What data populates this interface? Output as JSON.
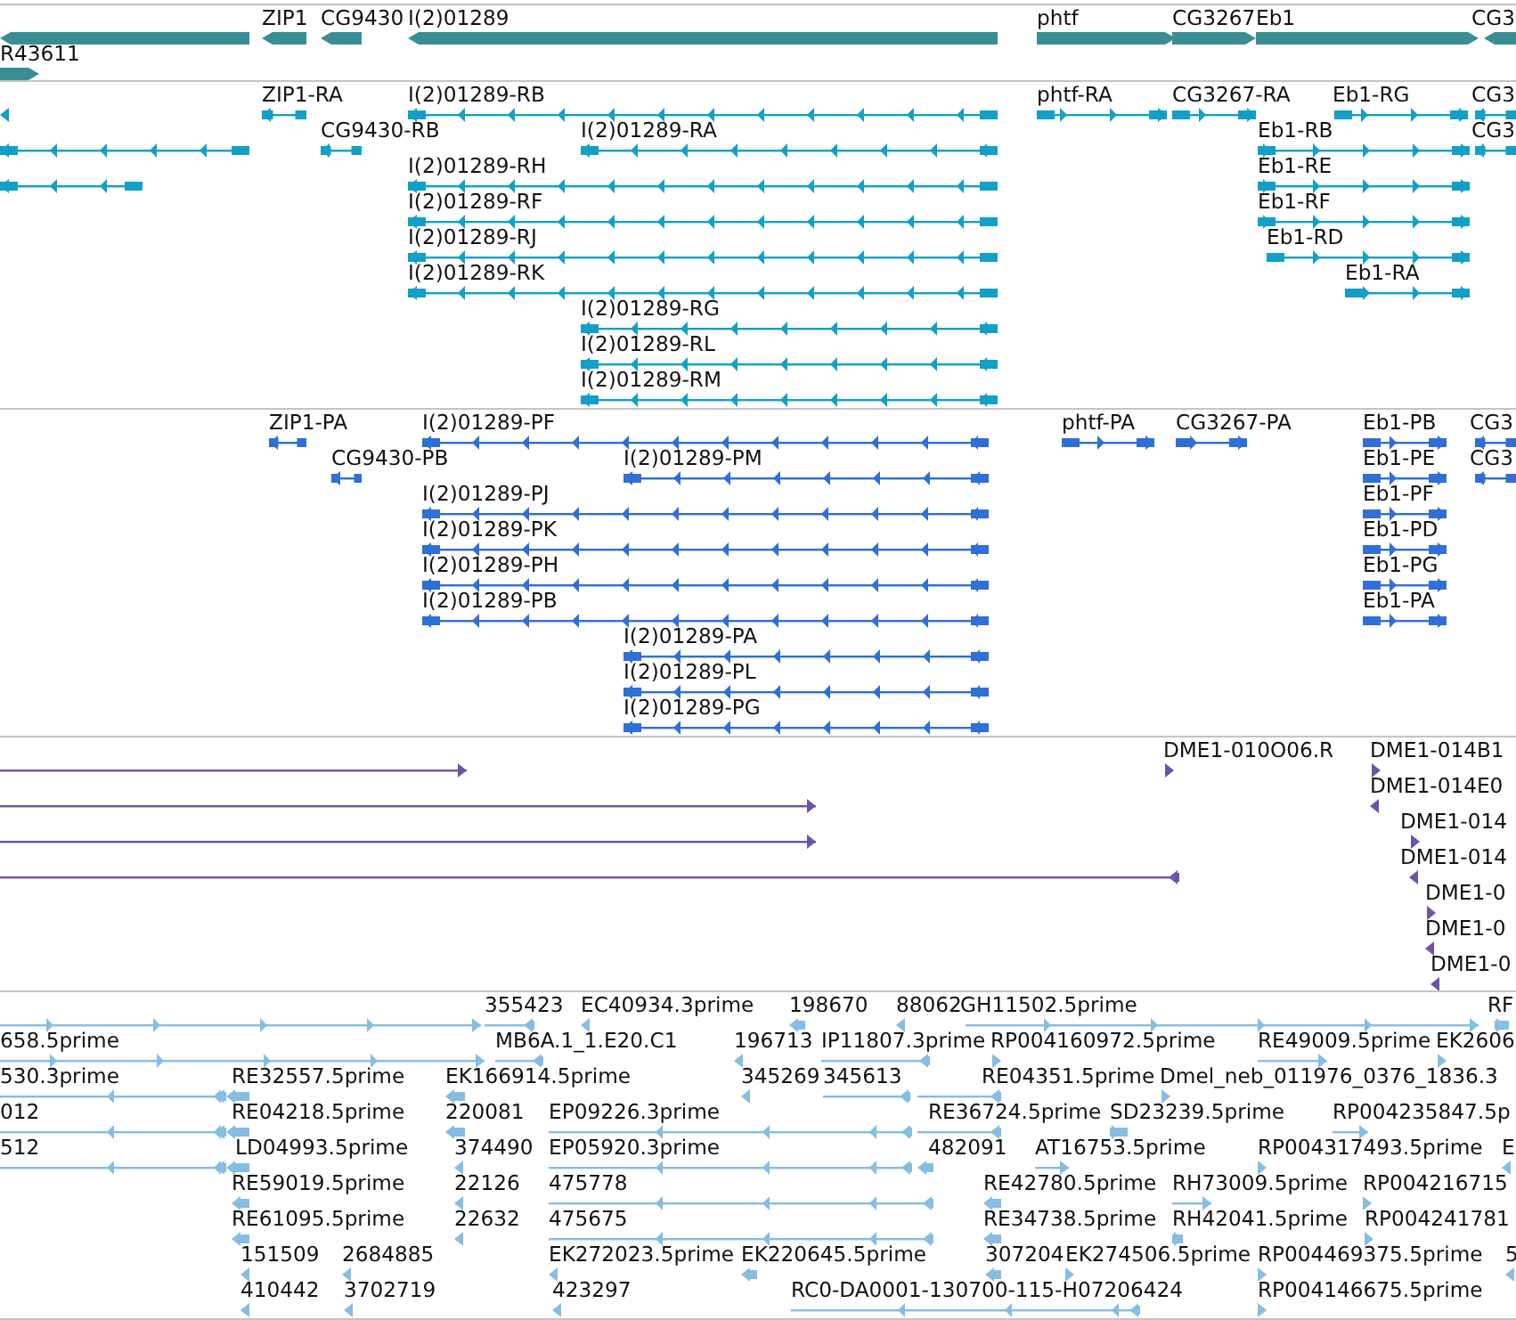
{
  "tracks": [
    {
      "kind": "gene",
      "lanes": [
        {
          "features": [
            {
              "reverse": true
            },
            {
              "label": "ZIP1",
              "reverse": true
            },
            {
              "label": "CG9430",
              "reverse": true
            },
            {
              "label": "I(2)01289",
              "reverse": true
            },
            {
              "label": "phtf",
              "reverse": false
            },
            {
              "label": "CG3267",
              "reverse": false
            },
            {
              "label": "Eb1",
              "reverse": false
            },
            {
              "label": "CG3",
              "reverse": true
            }
          ]
        },
        {
          "features": [
            {
              "label": "R43611",
              "reverse": false
            }
          ]
        }
      ]
    },
    {
      "kind": "transcript",
      "lanes": [
        {
          "features": [
            {
              "reverse": true
            },
            {
              "label": "ZIP1-RA",
              "reverse": true
            },
            {
              "label": "I(2)01289-RB",
              "reverse": true
            },
            {
              "label": "phtf-RA",
              "reverse": false
            },
            {
              "label": "CG3267-RA",
              "reverse": false
            },
            {
              "label": "Eb1-RG",
              "reverse": false
            },
            {
              "label": "CG3",
              "reverse": true
            }
          ]
        },
        {
          "features": [
            {
              "reverse": true
            },
            {
              "label": "CG9430-RB",
              "reverse": true
            },
            {
              "label": "I(2)01289-RA",
              "reverse": true
            },
            {
              "label": "Eb1-RB",
              "reverse": false
            },
            {
              "label": "CG3",
              "reverse": true
            }
          ]
        },
        {
          "features": [
            {
              "reverse": true
            },
            {
              "label": "I(2)01289-RH",
              "reverse": true
            },
            {
              "label": "Eb1-RE",
              "reverse": false
            }
          ]
        },
        {
          "features": [
            {
              "label": "I(2)01289-RF",
              "reverse": true
            },
            {
              "label": "Eb1-RF",
              "reverse": false
            }
          ]
        },
        {
          "features": [
            {
              "label": "I(2)01289-RJ",
              "reverse": true
            },
            {
              "label": "Eb1-RD",
              "reverse": false
            }
          ]
        },
        {
          "features": [
            {
              "label": "I(2)01289-RK",
              "reverse": true
            },
            {
              "label": "Eb1-RA",
              "reverse": false
            }
          ]
        },
        {
          "features": [
            {
              "label": "I(2)01289-RG",
              "reverse": true
            }
          ]
        },
        {
          "features": [
            {
              "label": "I(2)01289-RL",
              "reverse": true
            }
          ]
        },
        {
          "features": [
            {
              "label": "I(2)01289-RM",
              "reverse": true
            }
          ]
        }
      ]
    },
    {
      "kind": "protein",
      "lanes": [
        {
          "features": [
            {
              "label": "ZIP1-PA",
              "reverse": true
            },
            {
              "label": "I(2)01289-PF",
              "reverse": true
            },
            {
              "label": "phtf-PA",
              "reverse": false
            },
            {
              "label": "CG3267-PA",
              "reverse": false
            },
            {
              "label": "Eb1-PB",
              "reverse": false
            },
            {
              "label": "CG3",
              "reverse": true
            }
          ]
        },
        {
          "features": [
            {
              "label": "CG9430-PB",
              "reverse": true
            },
            {
              "label": "I(2)01289-PM",
              "reverse": true
            },
            {
              "label": "Eb1-PE",
              "reverse": false
            },
            {
              "label": "CG3",
              "reverse": true
            }
          ]
        },
        {
          "features": [
            {
              "label": "I(2)01289-PJ",
              "reverse": true
            },
            {
              "label": "Eb1-PF",
              "reverse": false
            }
          ]
        },
        {
          "features": [
            {
              "label": "I(2)01289-PK",
              "reverse": true
            },
            {
              "label": "Eb1-PD",
              "reverse": false
            }
          ]
        },
        {
          "features": [
            {
              "label": "I(2)01289-PH",
              "reverse": true
            },
            {
              "label": "Eb1-PG",
              "reverse": false
            }
          ]
        },
        {
          "features": [
            {
              "label": "I(2)01289-PB",
              "reverse": true
            },
            {
              "label": "Eb1-PA",
              "reverse": false
            }
          ]
        },
        {
          "features": [
            {
              "label": "I(2)01289-PA",
              "reverse": true
            }
          ]
        },
        {
          "features": [
            {
              "label": "I(2)01289-PL",
              "reverse": true
            }
          ]
        },
        {
          "features": [
            {
              "label": "I(2)01289-PG",
              "reverse": true
            }
          ]
        }
      ]
    },
    {
      "kind": "clone",
      "lanes": [
        {
          "features": [
            {
              "reverse": false
            },
            {
              "label": "DME1-010O06.R",
              "reverse": false
            },
            {
              "label": "DME1-014B1",
              "reverse": false
            }
          ]
        },
        {
          "features": [
            {
              "reverse": false
            },
            {
              "label": "DME1-014E0",
              "reverse": true
            }
          ]
        },
        {
          "features": [
            {
              "reverse": false
            },
            {
              "label": "DME1-014",
              "reverse": false
            }
          ]
        },
        {
          "features": [
            {
              "reverse": true
            },
            {
              "label": "DME1-014",
              "reverse": true
            }
          ]
        },
        {
          "features": [
            {
              "label": "DME1-0",
              "reverse": false
            }
          ]
        },
        {
          "features": [
            {
              "label": "DME1-0",
              "reverse": true
            }
          ]
        },
        {
          "features": [
            {
              "label": "DME1-0",
              "reverse": true
            }
          ]
        }
      ]
    },
    {
      "kind": "est",
      "lanes": [
        {
          "features": [
            {
              "reverse": false
            },
            {
              "label": "355423",
              "reverse": true
            },
            {
              "label": "EC40934.3prime",
              "reverse": true
            },
            {
              "label": "198670",
              "reverse": true
            },
            {
              "label": "88062",
              "reverse": true
            },
            {
              "label": "GH11502.5prime",
              "reverse": false
            },
            {
              "label": "RF",
              "reverse": false
            }
          ]
        },
        {
          "features": [
            {
              "label": "658.5prime",
              "reverse": false
            },
            {
              "label": "MB6A.1_1.E20.C1",
              "reverse": true
            },
            {
              "label": "196713",
              "reverse": true
            },
            {
              "label": "IP11807.3prime",
              "reverse": true
            },
            {
              "label": "RP004160972.5prime",
              "reverse": false
            },
            {
              "label": "RE49009.5prime",
              "reverse": false
            },
            {
              "label": "EK2606",
              "reverse": false
            }
          ]
        },
        {
          "features": [
            {
              "label": "530.3prime",
              "reverse": true
            },
            {
              "label": "RE32557.5prime",
              "reverse": true
            },
            {
              "label": "EK166914.5prime",
              "reverse": true
            },
            {
              "label": "345269",
              "reverse": true
            },
            {
              "label": "345613",
              "reverse": true
            },
            {
              "label": "RE04351.5prime",
              "reverse": true
            },
            {
              "label": "Dmel_neb_011976_0376_1836.3",
              "reverse": false
            }
          ]
        },
        {
          "features": [
            {
              "label": "012",
              "reverse": true
            },
            {
              "label": "RE04218.5prime",
              "reverse": true
            },
            {
              "label": "220081",
              "reverse": true
            },
            {
              "label": "EP09226.3prime",
              "reverse": true
            },
            {
              "label": "RE36724.5prime",
              "reverse": true
            },
            {
              "label": "SD23239.5prime",
              "reverse": false
            },
            {
              "label": "RP004235847.5p",
              "reverse": false
            }
          ]
        },
        {
          "features": [
            {
              "label": "512",
              "reverse": true
            },
            {
              "label": "LD04993.5prime",
              "reverse": true
            },
            {
              "label": "374490",
              "reverse": true
            },
            {
              "label": "EP05920.3prime",
              "reverse": true
            },
            {
              "label": "482091",
              "reverse": true
            },
            {
              "label": "AT16753.5prime",
              "reverse": false
            },
            {
              "label": "RP004317493.5prime",
              "reverse": false
            },
            {
              "label": "E",
              "reverse": true
            }
          ]
        },
        {
          "features": [
            {
              "label": "RE59019.5prime",
              "reverse": true
            },
            {
              "label": "22126",
              "reverse": true
            },
            {
              "label": "475778",
              "reverse": true
            },
            {
              "label": "RE42780.5prime",
              "reverse": true
            },
            {
              "label": "RH73009.5prime",
              "reverse": false
            },
            {
              "label": "RP004216715",
              "reverse": false
            }
          ]
        },
        {
          "features": [
            {
              "label": "RE61095.5prime",
              "reverse": true
            },
            {
              "label": "22632",
              "reverse": true
            },
            {
              "label": "475675",
              "reverse": true
            },
            {
              "label": "RE34738.5prime",
              "reverse": true
            },
            {
              "label": "RH42041.5prime",
              "reverse": false
            },
            {
              "label": "RP004241781",
              "reverse": false
            }
          ]
        },
        {
          "features": [
            {
              "label": "151509",
              "reverse": true
            },
            {
              "label": "2684885",
              "reverse": true
            },
            {
              "label": "EK272023.5prime",
              "reverse": true
            },
            {
              "label": "EK220645.5prime",
              "reverse": true
            },
            {
              "label": "307204",
              "reverse": true
            },
            {
              "label": "EK274506.5prime",
              "reverse": false
            },
            {
              "label": "RP004469375.5prime",
              "reverse": false
            },
            {
              "label": "5",
              "reverse": true
            }
          ]
        },
        {
          "features": [
            {
              "label": "410442",
              "reverse": true
            },
            {
              "label": "3702719",
              "reverse": true
            },
            {
              "label": "423297",
              "reverse": true
            },
            {
              "label": "RC0-DA0001-130700-115-H07206424",
              "reverse": true
            },
            {
              "label": "RP004146675.5prime",
              "reverse": false
            }
          ]
        }
      ]
    }
  ]
}
